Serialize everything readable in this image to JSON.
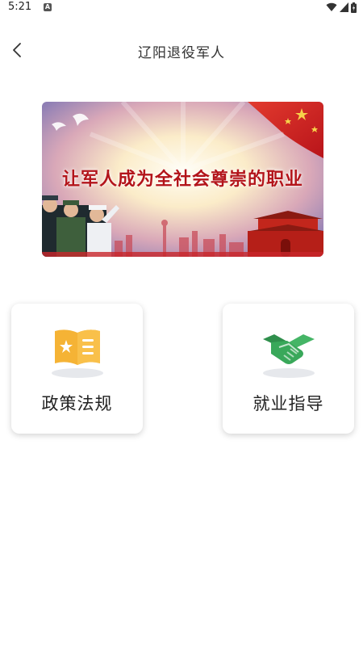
{
  "status_bar": {
    "time": "5:21",
    "notification_badge": "A"
  },
  "nav": {
    "title": "辽阳退役军人",
    "back_icon": "chevron-left-icon"
  },
  "banner": {
    "text": "让军人成为全社会尊崇的职业"
  },
  "cards": [
    {
      "label": "政策法规",
      "icon": "policy-book-icon",
      "color": "#F5B335"
    },
    {
      "label": "就业指导",
      "icon": "handshake-icon",
      "color": "#39A85A"
    }
  ],
  "colors": {
    "accent_red": "#B3141A",
    "card_shadow": "rgba(0,0,0,0.18)"
  }
}
